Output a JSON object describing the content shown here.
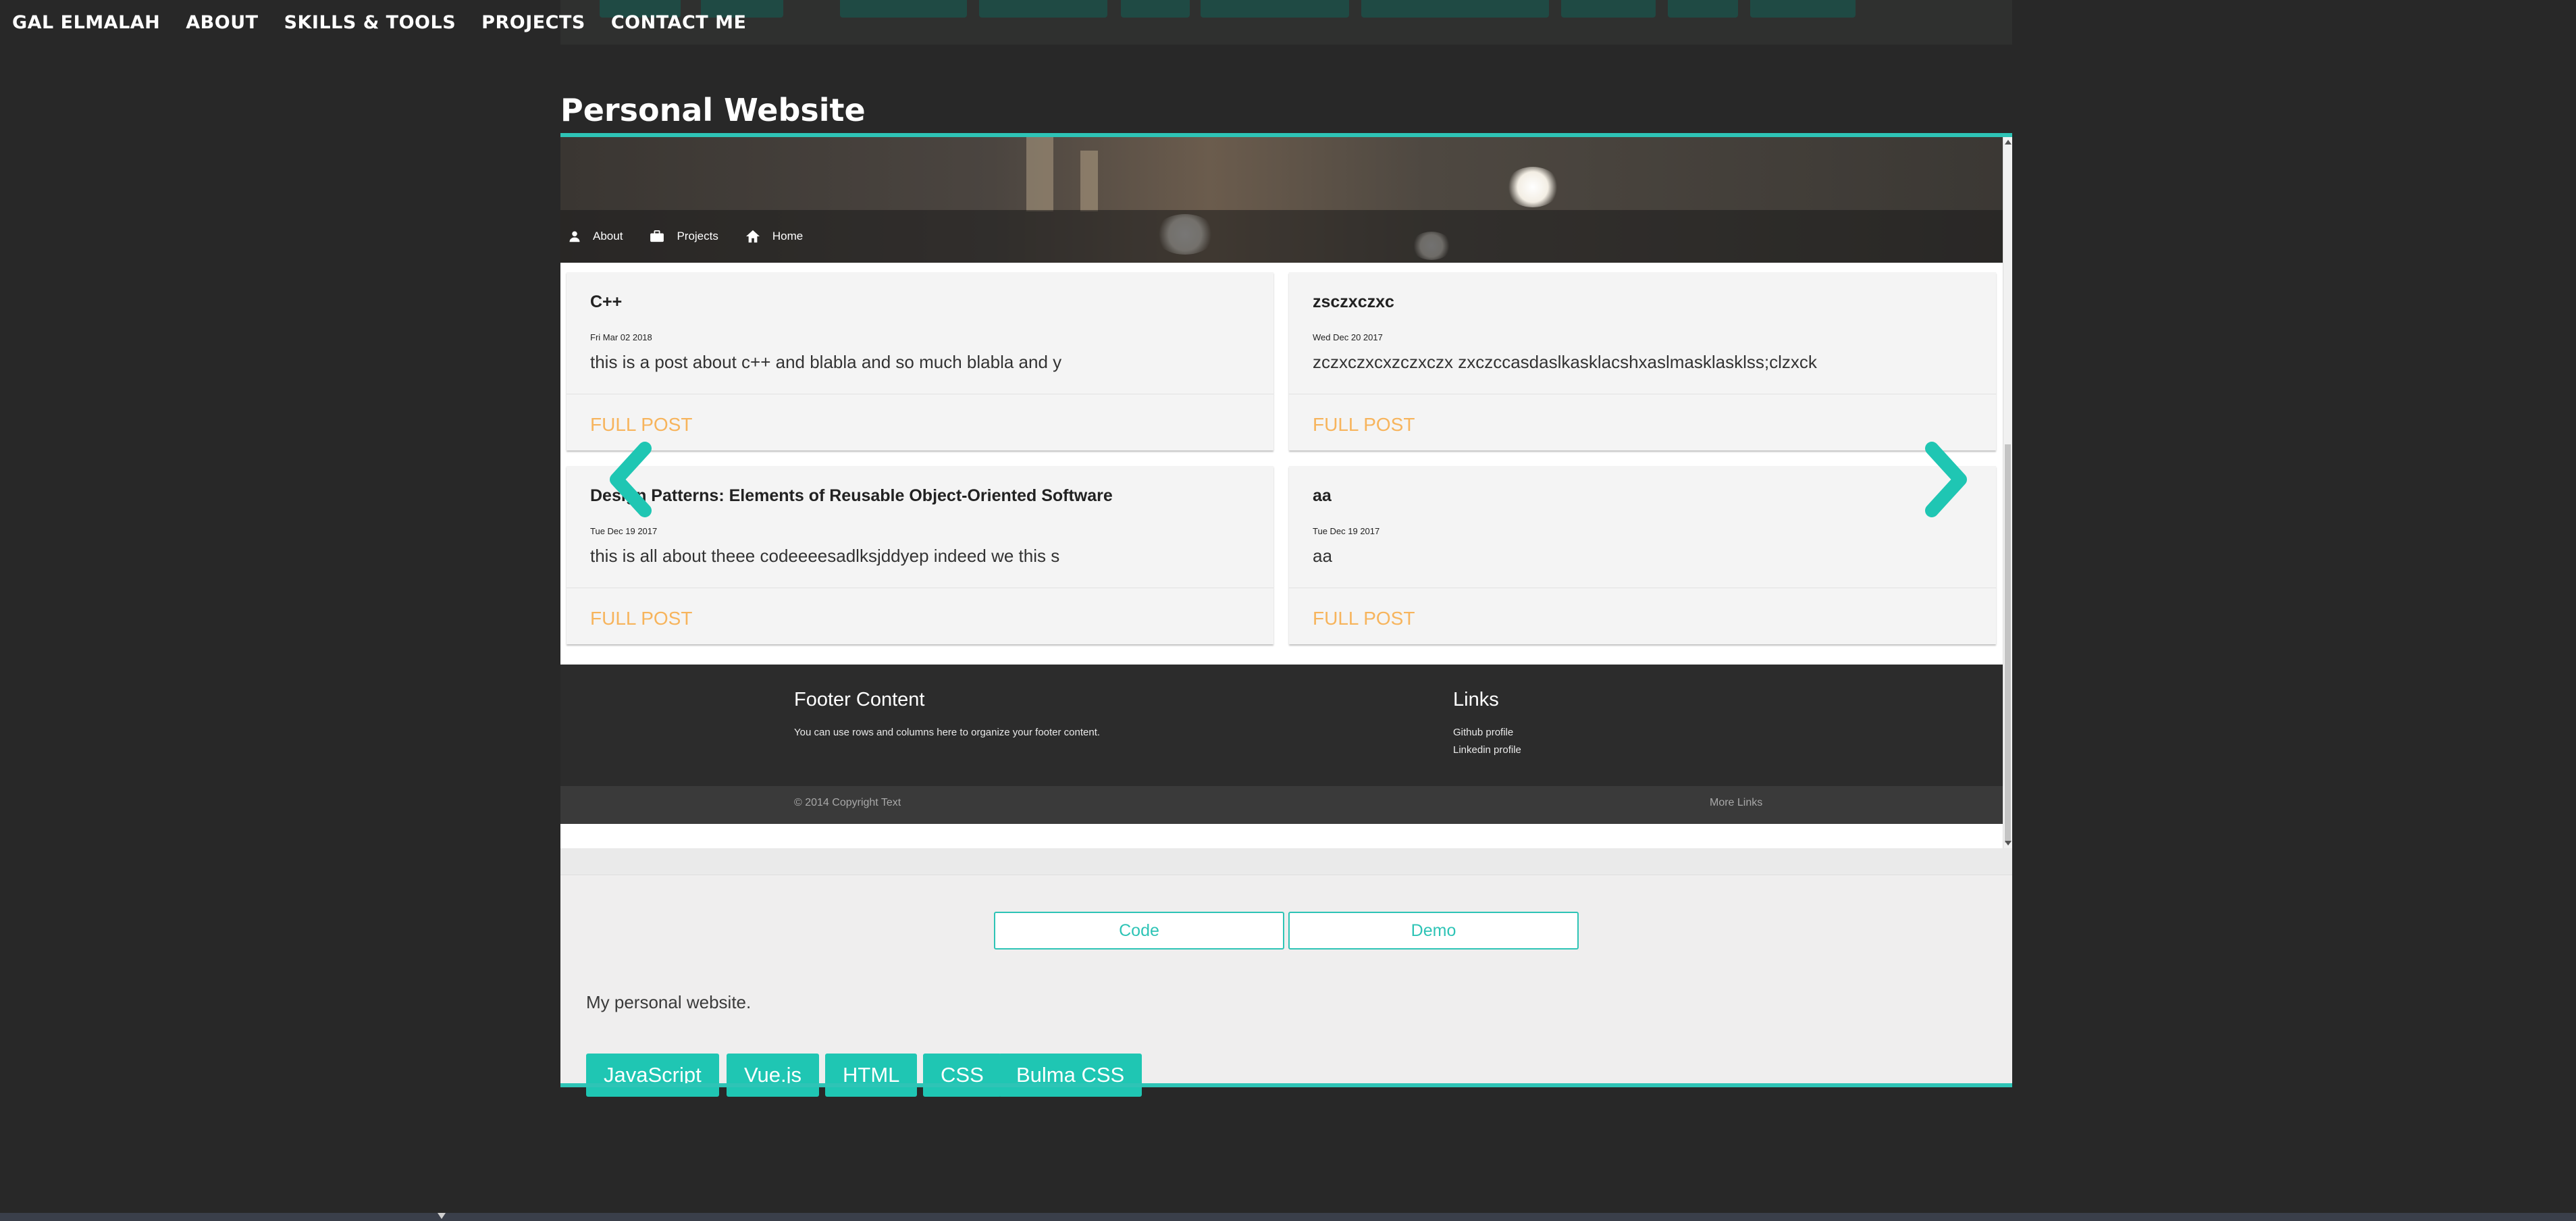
{
  "topnav": {
    "items": [
      "GAL ELMALAH",
      "ABOUT",
      "SKILLS & TOOLS",
      "PROJECTS",
      "CONTACT ME"
    ]
  },
  "project": {
    "title": "Personal Website",
    "accent_color": "#2ec4b6",
    "screenshot": {
      "nav": [
        "About",
        "Projects",
        "Home"
      ],
      "posts": [
        {
          "title": "C++",
          "date": "Fri Mar 02 2018",
          "excerpt": "this is a post about c++ and blabla and so much blabla and y",
          "link": "FULL POST"
        },
        {
          "title": "zsczxczxc",
          "date": "Wed Dec 20 2017",
          "excerpt": "zczxczxcxzczxczx zxczccasdaslkasklacshxaslmasklasklss;clzxck",
          "link": "FULL POST"
        },
        {
          "title": "Design Patterns: Elements of Reusable Object-Oriented Software",
          "date": "Tue Dec 19 2017",
          "excerpt": "this is all about theee codeeeesadlksjddyep indeed we this s",
          "link": "FULL POST"
        },
        {
          "title": "aa",
          "date": "Tue Dec 19 2017",
          "excerpt": "aa",
          "link": "FULL POST"
        }
      ],
      "footer": {
        "heading": "Footer Content",
        "text": "You can use rows and columns here to organize your footer content.",
        "links_heading": "Links",
        "links": [
          "Github profile",
          "Linkedin profile"
        ],
        "copyright": "© 2014 Copyright Text",
        "more_links": "More Links"
      }
    },
    "buttons": {
      "code": "Code",
      "demo": "Demo"
    },
    "description": "My personal website.",
    "tags": [
      "JavaScript",
      "Vue.js",
      "HTML",
      "CSS",
      "Bulma CSS"
    ]
  },
  "colors": {
    "background": "#282828",
    "accent": "#2ec4b6",
    "tag": "#1fc6b3",
    "full_post_link": "#f7b45c"
  },
  "icons": {
    "prev": "chevron-left-icon",
    "next": "chevron-right-icon",
    "about": "person-icon",
    "projects": "briefcase-icon",
    "home": "home-icon"
  }
}
